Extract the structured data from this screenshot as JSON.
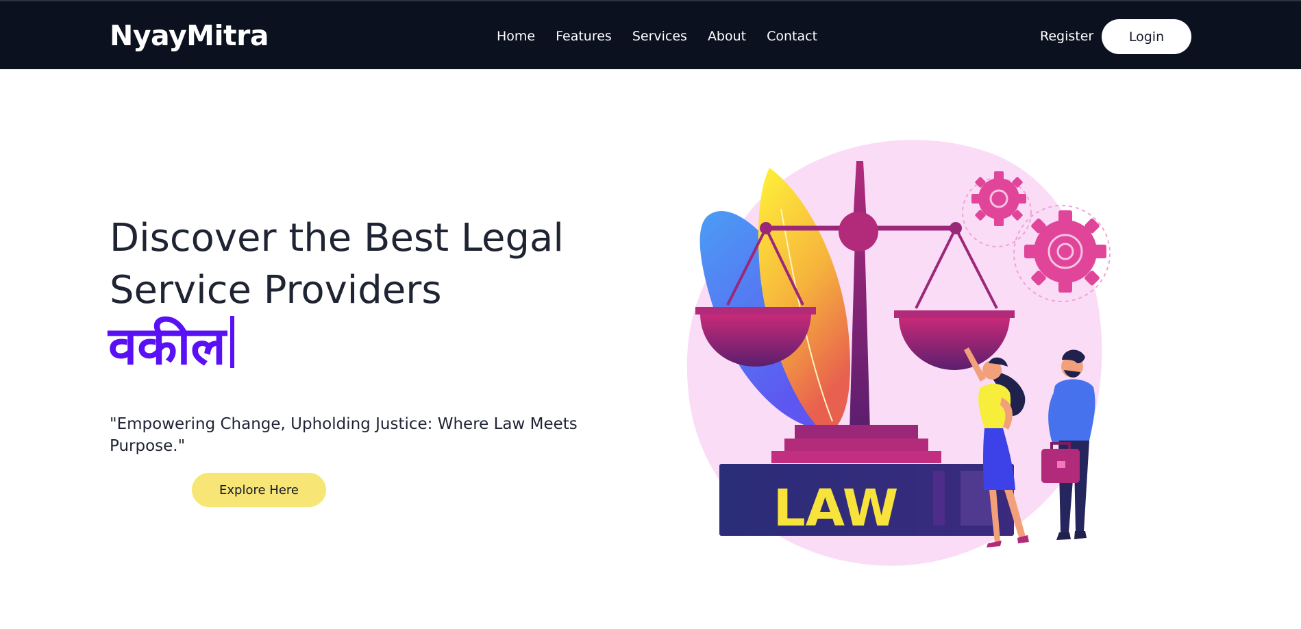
{
  "navbar": {
    "brand": "NyayMitra",
    "links": [
      {
        "label": "Home"
      },
      {
        "label": "Features"
      },
      {
        "label": "Services"
      },
      {
        "label": "About"
      },
      {
        "label": "Contact"
      }
    ],
    "register_label": "Register",
    "login_label": "Login"
  },
  "hero": {
    "title": "Discover the Best Legal Service Providers",
    "typed_word": "वकील",
    "tagline": "\"Empowering Change, Upholding Justice: Where Law Meets Purpose.\"",
    "cta_label": "Explore Here"
  },
  "illustration": {
    "icon": "justice-scale-illustration",
    "book_label": "LAW"
  },
  "colors": {
    "nav_background": "#0c1120",
    "accent_purple": "#5a10f5",
    "cta_yellow": "#f7e675",
    "blob_pink": "#fadcf6"
  }
}
